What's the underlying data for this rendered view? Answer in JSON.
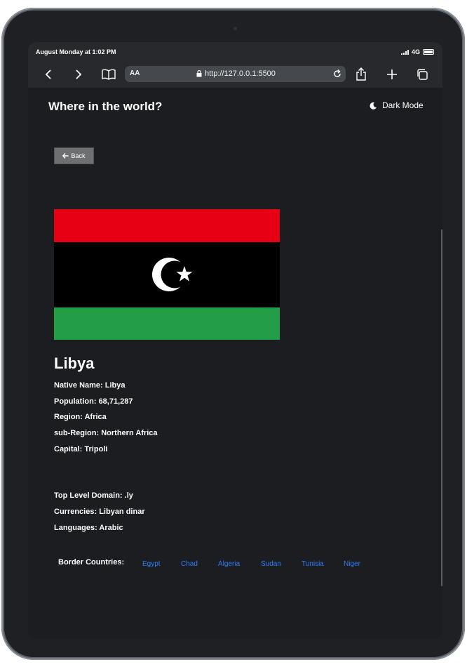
{
  "status": {
    "time": "August Monday at 1:02 PM",
    "network": "4G"
  },
  "browser": {
    "text_size_label": "AA",
    "url": "http://127.0.0.1:5500"
  },
  "header": {
    "title": "Where in the world?",
    "mode_label": "Dark Mode"
  },
  "back_label": "Back",
  "country": {
    "name": "Libya",
    "flag_colors": {
      "top": "#e70013",
      "middle": "#000000",
      "bottom": "#239e46",
      "emblem": "#ffffff"
    },
    "details": [
      {
        "label": "Native Name:",
        "value": "Libya"
      },
      {
        "label": "Population:",
        "value": "68,71,287"
      },
      {
        "label": "Region:",
        "value": "Africa"
      },
      {
        "label": "sub-Region:",
        "value": "Northern Africa"
      },
      {
        "label": "Capital:",
        "value": "Tripoli"
      }
    ],
    "extra_details": [
      {
        "label": "Top Level Domain:",
        "value": ".ly"
      },
      {
        "label": "Currencies:",
        "value": "Libyan dinar"
      },
      {
        "label": "Languages:",
        "value": "Arabic"
      }
    ],
    "border_label": "Border Countries:",
    "borders": [
      "Egypt",
      "Chad",
      "Algeria",
      "Sudan",
      "Tunisia",
      "Niger"
    ]
  },
  "colors": {
    "link": "#2f7dff",
    "background": "#1b1d20"
  }
}
